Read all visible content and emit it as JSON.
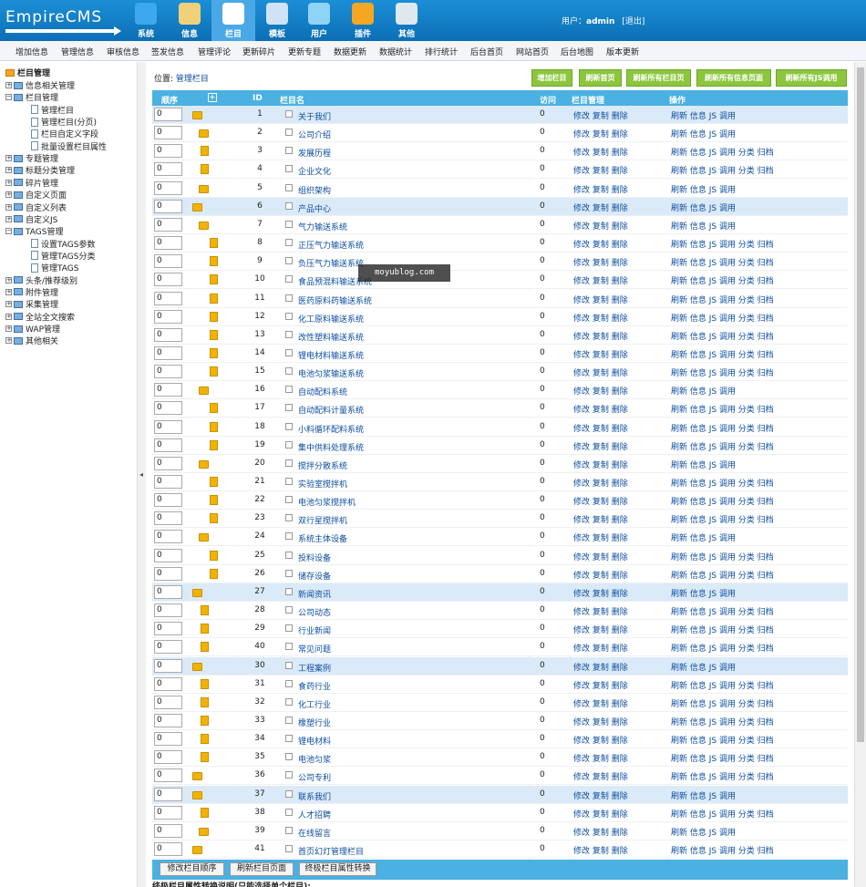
{
  "logo": "EmpireCMS",
  "nav": [
    {
      "label": "系统",
      "icon": "globe-icon",
      "color": "#3da8ee"
    },
    {
      "label": "信息",
      "icon": "edit-doc-icon",
      "color": "#f2d07a"
    },
    {
      "label": "栏目",
      "icon": "folder-icon",
      "color": "#ffffff"
    },
    {
      "label": "模板",
      "icon": "template-icon",
      "color": "#cfe3f5"
    },
    {
      "label": "用户",
      "icon": "user-icon",
      "color": "#8fd3f6"
    },
    {
      "label": "插件",
      "icon": "tools-icon",
      "color": "#f5a623"
    },
    {
      "label": "其他",
      "icon": "gear-icon",
      "color": "#dfe7ef"
    }
  ],
  "user": {
    "prefix": "用户：",
    "name": "admin",
    "logout": "[退出]"
  },
  "menu": [
    "增加信息",
    "管理信息",
    "审核信息",
    "签发信息",
    "管理评论",
    "更新碎片",
    "更新专题",
    "数据更新",
    "数据统计",
    "排行统计",
    "后台首页",
    "网站首页",
    "后台地图",
    "版本更新"
  ],
  "tree": {
    "root": "栏目管理",
    "items": [
      "信息相关管理",
      "栏目管理",
      "管理栏目",
      "管理栏目(分页)",
      "栏目自定义字段",
      "批量设置栏目属性",
      "专题管理",
      "标题分类管理",
      "碎片管理",
      "自定义页面",
      "自定义列表",
      "自定义JS",
      "TAGS管理",
      "设置TAGS参数",
      "管理TAGS分类",
      "管理TAGS",
      "头条/推荐级别",
      "附件管理",
      "采集管理",
      "全站全文搜索",
      "WAP管理",
      "其他相关"
    ]
  },
  "location": {
    "label": "位置:",
    "link": "管理栏目"
  },
  "actions": [
    "增加栏目",
    "刷新首页",
    "刷新所有栏目页",
    "刷新所有信息页面",
    "刷新所有JS调用"
  ],
  "table": {
    "headers": [
      "顺序",
      "ID",
      "栏目名",
      "访问",
      "栏目管理",
      "操作"
    ],
    "expand": "+",
    "manage": "修改 复制 删除",
    "op_short": "刷新 信息 JS 调用",
    "op_long": "刷新 信息 JS 调用 分类 归档",
    "rows": [
      {
        "order": "0",
        "id": "1",
        "name": "关于我们",
        "visits": "0",
        "level": 0,
        "hl": true,
        "long": false
      },
      {
        "order": "0",
        "id": "2",
        "name": "公司介绍",
        "visits": "0",
        "level": 1,
        "hl": false,
        "long": false,
        "folder": true
      },
      {
        "order": "0",
        "id": "3",
        "name": "发展历程",
        "visits": "0",
        "level": 1,
        "hl": false,
        "long": true
      },
      {
        "order": "0",
        "id": "4",
        "name": "企业文化",
        "visits": "0",
        "level": 1,
        "hl": false,
        "long": true
      },
      {
        "order": "0",
        "id": "5",
        "name": "组织架构",
        "visits": "0",
        "level": 1,
        "hl": false,
        "long": false,
        "folder": true
      },
      {
        "order": "0",
        "id": "6",
        "name": "产品中心",
        "visits": "0",
        "level": 0,
        "hl": true,
        "long": false
      },
      {
        "order": "0",
        "id": "7",
        "name": "气力输送系统",
        "visits": "0",
        "level": 1,
        "hl": false,
        "long": false,
        "folder": true
      },
      {
        "order": "0",
        "id": "8",
        "name": "正压气力输送系统",
        "visits": "0",
        "level": 2,
        "hl": false,
        "long": true
      },
      {
        "order": "0",
        "id": "9",
        "name": "负压气力输送系统",
        "visits": "0",
        "level": 2,
        "hl": false,
        "long": true
      },
      {
        "order": "0",
        "id": "10",
        "name": "食品预混料输送系统",
        "visits": "0",
        "level": 2,
        "hl": false,
        "long": true
      },
      {
        "order": "0",
        "id": "11",
        "name": "医药原料药输送系统",
        "visits": "0",
        "level": 2,
        "hl": false,
        "long": true
      },
      {
        "order": "0",
        "id": "12",
        "name": "化工原料输送系统",
        "visits": "0",
        "level": 2,
        "hl": false,
        "long": true
      },
      {
        "order": "0",
        "id": "13",
        "name": "改性塑料输送系统",
        "visits": "0",
        "level": 2,
        "hl": false,
        "long": true
      },
      {
        "order": "0",
        "id": "14",
        "name": "锂电材料输送系统",
        "visits": "0",
        "level": 2,
        "hl": false,
        "long": true
      },
      {
        "order": "0",
        "id": "15",
        "name": "电池匀浆输送系统",
        "visits": "0",
        "level": 2,
        "hl": false,
        "long": true
      },
      {
        "order": "0",
        "id": "16",
        "name": "自动配料系统",
        "visits": "0",
        "level": 1,
        "hl": false,
        "long": false,
        "folder": true
      },
      {
        "order": "0",
        "id": "17",
        "name": "自动配料计量系统",
        "visits": "0",
        "level": 2,
        "hl": false,
        "long": true
      },
      {
        "order": "0",
        "id": "18",
        "name": "小料循环配料系统",
        "visits": "0",
        "level": 2,
        "hl": false,
        "long": true
      },
      {
        "order": "0",
        "id": "19",
        "name": "集中供料处理系统",
        "visits": "0",
        "level": 2,
        "hl": false,
        "long": true
      },
      {
        "order": "0",
        "id": "20",
        "name": "搅拌分散系统",
        "visits": "0",
        "level": 1,
        "hl": false,
        "long": false,
        "folder": true
      },
      {
        "order": "0",
        "id": "21",
        "name": "实验室搅拌机",
        "visits": "0",
        "level": 2,
        "hl": false,
        "long": true
      },
      {
        "order": "0",
        "id": "22",
        "name": "电池匀浆搅拌机",
        "visits": "0",
        "level": 2,
        "hl": false,
        "long": true
      },
      {
        "order": "0",
        "id": "23",
        "name": "双行星搅拌机",
        "visits": "0",
        "level": 2,
        "hl": false,
        "long": true
      },
      {
        "order": "0",
        "id": "24",
        "name": "系统主体设备",
        "visits": "0",
        "level": 1,
        "hl": false,
        "long": false,
        "folder": true
      },
      {
        "order": "0",
        "id": "25",
        "name": "投料设备",
        "visits": "0",
        "level": 2,
        "hl": false,
        "long": true
      },
      {
        "order": "0",
        "id": "26",
        "name": "储存设备",
        "visits": "0",
        "level": 2,
        "hl": false,
        "long": true
      },
      {
        "order": "0",
        "id": "27",
        "name": "新闻资讯",
        "visits": "0",
        "level": 0,
        "hl": true,
        "long": false
      },
      {
        "order": "0",
        "id": "28",
        "name": "公司动态",
        "visits": "0",
        "level": 1,
        "hl": false,
        "long": true
      },
      {
        "order": "0",
        "id": "29",
        "name": "行业新闻",
        "visits": "0",
        "level": 1,
        "hl": false,
        "long": true
      },
      {
        "order": "0",
        "id": "40",
        "name": "常见问题",
        "visits": "0",
        "level": 1,
        "hl": false,
        "long": true
      },
      {
        "order": "0",
        "id": "30",
        "name": "工程案例",
        "visits": "0",
        "level": 0,
        "hl": true,
        "long": false
      },
      {
        "order": "0",
        "id": "31",
        "name": "食药行业",
        "visits": "0",
        "level": 1,
        "hl": false,
        "long": true
      },
      {
        "order": "0",
        "id": "32",
        "name": "化工行业",
        "visits": "0",
        "level": 1,
        "hl": false,
        "long": true
      },
      {
        "order": "0",
        "id": "33",
        "name": "橡塑行业",
        "visits": "0",
        "level": 1,
        "hl": false,
        "long": true
      },
      {
        "order": "0",
        "id": "34",
        "name": "锂电材料",
        "visits": "0",
        "level": 1,
        "hl": false,
        "long": true
      },
      {
        "order": "0",
        "id": "35",
        "name": "电池匀浆",
        "visits": "0",
        "level": 1,
        "hl": false,
        "long": true
      },
      {
        "order": "0",
        "id": "36",
        "name": "公司专利",
        "visits": "0",
        "level": 0,
        "hl": false,
        "long": true
      },
      {
        "order": "0",
        "id": "37",
        "name": "联系我们",
        "visits": "0",
        "level": 0,
        "hl": true,
        "long": false
      },
      {
        "order": "0",
        "id": "38",
        "name": "人才招聘",
        "visits": "0",
        "level": 1,
        "hl": false,
        "long": true
      },
      {
        "order": "0",
        "id": "39",
        "name": "在线留言",
        "visits": "0",
        "level": 1,
        "hl": false,
        "long": false,
        "folder": true
      },
      {
        "order": "0",
        "id": "41",
        "name": "首页幻灯管理栏目",
        "visits": "0",
        "level": 0,
        "hl": false,
        "long": true
      }
    ]
  },
  "bottom": [
    "修改栏目顺序",
    "刷新栏目页面",
    "终极栏目属性转换"
  ],
  "trail": "终极栏目属性转换说明(只能选择单个栏目):",
  "watermark": "moyublog.com"
}
